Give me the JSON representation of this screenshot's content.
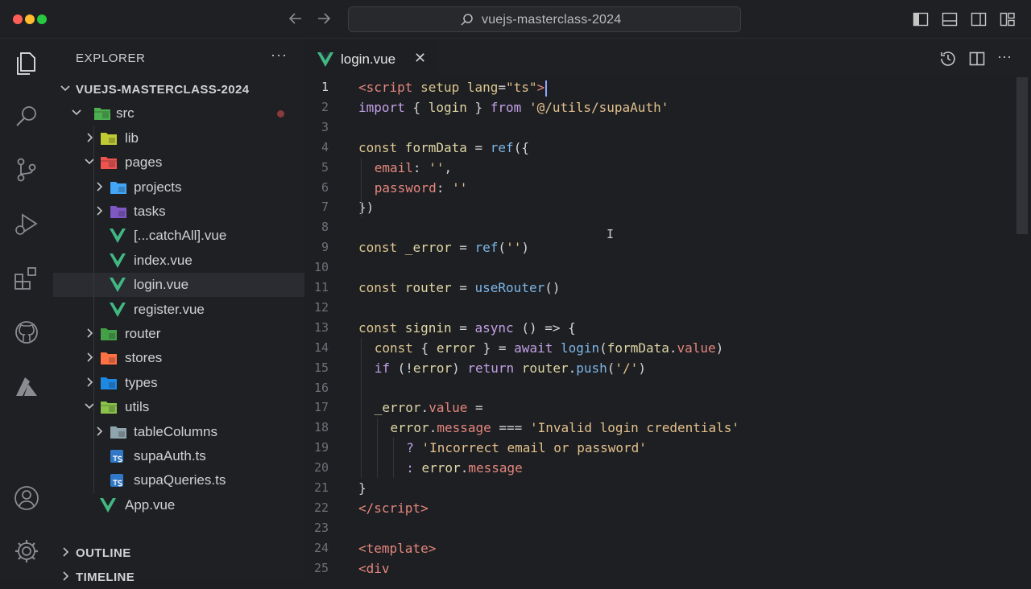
{
  "window": {
    "search_label": "vuejs-masterclass-2024"
  },
  "explorer": {
    "title": "EXPLORER",
    "more": "···",
    "root": "VUEJS-MASTERCLASS-2024",
    "items": [
      {
        "label": "src",
        "depth": 1,
        "type": "folder-open",
        "icon_color": "#4caf50"
      },
      {
        "label": "lib",
        "depth": 2,
        "type": "folder",
        "icon_color": "#c0ca33"
      },
      {
        "label": "pages",
        "depth": 2,
        "type": "folder-open",
        "icon_color": "#ef5350"
      },
      {
        "label": "projects",
        "depth": 3,
        "type": "folder",
        "icon_color": "#42a5f5"
      },
      {
        "label": "tasks",
        "depth": 3,
        "type": "folder",
        "icon_color": "#7e57c2"
      },
      {
        "label": "[...catchAll].vue",
        "depth": 3,
        "type": "vue"
      },
      {
        "label": "index.vue",
        "depth": 3,
        "type": "vue"
      },
      {
        "label": "login.vue",
        "depth": 3,
        "type": "vue",
        "selected": true
      },
      {
        "label": "register.vue",
        "depth": 3,
        "type": "vue"
      },
      {
        "label": "router",
        "depth": 2,
        "type": "folder",
        "icon_color": "#43a047"
      },
      {
        "label": "stores",
        "depth": 2,
        "type": "folder",
        "icon_color": "#ff7043"
      },
      {
        "label": "types",
        "depth": 2,
        "type": "folder",
        "icon_color": "#1e88e5"
      },
      {
        "label": "utils",
        "depth": 2,
        "type": "folder-open",
        "icon_color": "#8bc34a"
      },
      {
        "label": "tableColumns",
        "depth": 3,
        "type": "folder",
        "icon_color": "#90a4ae"
      },
      {
        "label": "supaAuth.ts",
        "depth": 3,
        "type": "ts"
      },
      {
        "label": "supaQueries.ts",
        "depth": 3,
        "type": "ts"
      },
      {
        "label": "App.vue",
        "depth": 2,
        "type": "vue"
      }
    ],
    "outline": "OUTLINE",
    "timeline": "TIMELINE"
  },
  "editor": {
    "tab_label": "login.vue",
    "tab_close": "✕",
    "current_line": 1,
    "lines": [
      {
        "n": "1"
      },
      {
        "n": "2"
      },
      {
        "n": "3"
      },
      {
        "n": "4"
      },
      {
        "n": "5"
      },
      {
        "n": "6"
      },
      {
        "n": "7"
      },
      {
        "n": "8"
      },
      {
        "n": "9"
      },
      {
        "n": "10"
      },
      {
        "n": "11"
      },
      {
        "n": "12"
      },
      {
        "n": "13"
      },
      {
        "n": "14"
      },
      {
        "n": "15"
      },
      {
        "n": "16"
      },
      {
        "n": "17"
      },
      {
        "n": "18"
      },
      {
        "n": "19"
      },
      {
        "n": "20"
      },
      {
        "n": "21"
      },
      {
        "n": "22"
      },
      {
        "n": "23"
      },
      {
        "n": "24"
      },
      {
        "n": "25"
      }
    ],
    "code": {
      "l1": [
        "<script",
        " setup",
        " lang",
        "=",
        "\"ts\"",
        ">"
      ],
      "l2": [
        "import",
        " { ",
        "login",
        " } ",
        "from",
        " '@/utils/supaAuth'"
      ],
      "l4": [
        "const",
        " formData",
        " = ",
        "ref",
        "({"
      ],
      "l5": [
        "email",
        ": ",
        "''",
        ","
      ],
      "l6": [
        "password",
        ": ",
        "''"
      ],
      "l7": [
        "})"
      ],
      "l9": [
        "const",
        " _error",
        " = ",
        "ref",
        "(",
        "''",
        ")"
      ],
      "l11": [
        "const",
        " router",
        " = ",
        "useRouter",
        "()"
      ],
      "l13": [
        "const",
        " signin",
        " = ",
        "async",
        " () => {"
      ],
      "l14": [
        "const",
        " { ",
        "error",
        " } = ",
        "await",
        " ",
        "login",
        "(",
        "formData",
        ".",
        "value",
        ")"
      ],
      "l15": [
        "if",
        " (!",
        "error",
        ") ",
        "return",
        " ",
        "router",
        ".",
        "push",
        "(",
        "'/'",
        ")"
      ],
      "l17": [
        "_error",
        ".",
        "value",
        " ="
      ],
      "l18": [
        "error",
        ".",
        "message",
        " === ",
        "'Invalid login credentials'"
      ],
      "l19": [
        "? ",
        "'Incorrect email or password'"
      ],
      "l20": [
        ": ",
        "error",
        ".",
        "message"
      ],
      "l21": [
        "}"
      ],
      "l22": [
        "</script",
        ">"
      ],
      "l24": [
        "<template",
        ">"
      ],
      "l25": [
        "<div"
      ]
    }
  },
  "colors": {
    "accent": "#8aa9ff",
    "vue_green": "#41b883",
    "ts_blue": "#3178c6"
  }
}
